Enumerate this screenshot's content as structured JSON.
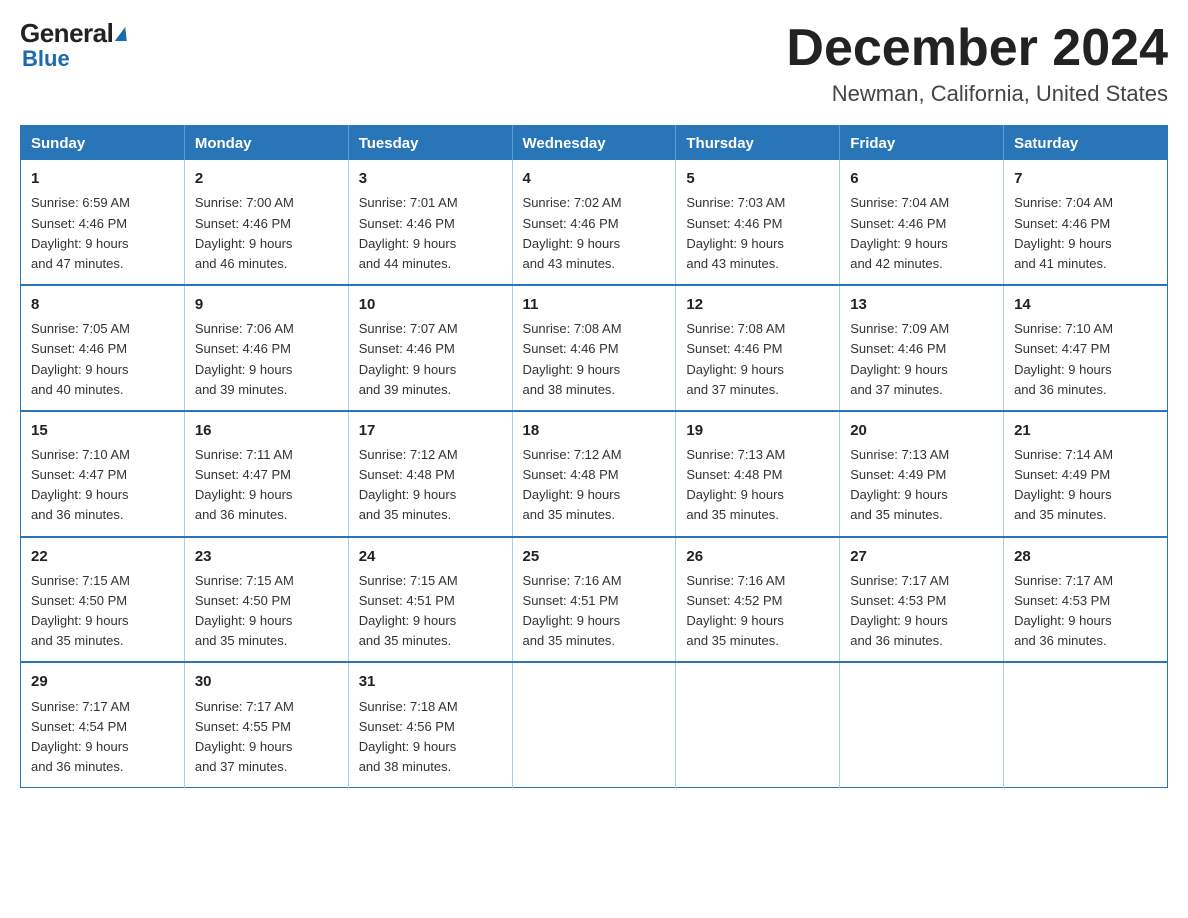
{
  "logo": {
    "general": "General",
    "arrow_symbol": "▶",
    "blue": "Blue"
  },
  "header": {
    "title": "December 2024",
    "subtitle": "Newman, California, United States"
  },
  "weekdays": [
    "Sunday",
    "Monday",
    "Tuesday",
    "Wednesday",
    "Thursday",
    "Friday",
    "Saturday"
  ],
  "weeks": [
    [
      {
        "day": "1",
        "sunrise": "6:59 AM",
        "sunset": "4:46 PM",
        "daylight": "9 hours and 47 minutes."
      },
      {
        "day": "2",
        "sunrise": "7:00 AM",
        "sunset": "4:46 PM",
        "daylight": "9 hours and 46 minutes."
      },
      {
        "day": "3",
        "sunrise": "7:01 AM",
        "sunset": "4:46 PM",
        "daylight": "9 hours and 44 minutes."
      },
      {
        "day": "4",
        "sunrise": "7:02 AM",
        "sunset": "4:46 PM",
        "daylight": "9 hours and 43 minutes."
      },
      {
        "day": "5",
        "sunrise": "7:03 AM",
        "sunset": "4:46 PM",
        "daylight": "9 hours and 43 minutes."
      },
      {
        "day": "6",
        "sunrise": "7:04 AM",
        "sunset": "4:46 PM",
        "daylight": "9 hours and 42 minutes."
      },
      {
        "day": "7",
        "sunrise": "7:04 AM",
        "sunset": "4:46 PM",
        "daylight": "9 hours and 41 minutes."
      }
    ],
    [
      {
        "day": "8",
        "sunrise": "7:05 AM",
        "sunset": "4:46 PM",
        "daylight": "9 hours and 40 minutes."
      },
      {
        "day": "9",
        "sunrise": "7:06 AM",
        "sunset": "4:46 PM",
        "daylight": "9 hours and 39 minutes."
      },
      {
        "day": "10",
        "sunrise": "7:07 AM",
        "sunset": "4:46 PM",
        "daylight": "9 hours and 39 minutes."
      },
      {
        "day": "11",
        "sunrise": "7:08 AM",
        "sunset": "4:46 PM",
        "daylight": "9 hours and 38 minutes."
      },
      {
        "day": "12",
        "sunrise": "7:08 AM",
        "sunset": "4:46 PM",
        "daylight": "9 hours and 37 minutes."
      },
      {
        "day": "13",
        "sunrise": "7:09 AM",
        "sunset": "4:46 PM",
        "daylight": "9 hours and 37 minutes."
      },
      {
        "day": "14",
        "sunrise": "7:10 AM",
        "sunset": "4:47 PM",
        "daylight": "9 hours and 36 minutes."
      }
    ],
    [
      {
        "day": "15",
        "sunrise": "7:10 AM",
        "sunset": "4:47 PM",
        "daylight": "9 hours and 36 minutes."
      },
      {
        "day": "16",
        "sunrise": "7:11 AM",
        "sunset": "4:47 PM",
        "daylight": "9 hours and 36 minutes."
      },
      {
        "day": "17",
        "sunrise": "7:12 AM",
        "sunset": "4:48 PM",
        "daylight": "9 hours and 35 minutes."
      },
      {
        "day": "18",
        "sunrise": "7:12 AM",
        "sunset": "4:48 PM",
        "daylight": "9 hours and 35 minutes."
      },
      {
        "day": "19",
        "sunrise": "7:13 AM",
        "sunset": "4:48 PM",
        "daylight": "9 hours and 35 minutes."
      },
      {
        "day": "20",
        "sunrise": "7:13 AM",
        "sunset": "4:49 PM",
        "daylight": "9 hours and 35 minutes."
      },
      {
        "day": "21",
        "sunrise": "7:14 AM",
        "sunset": "4:49 PM",
        "daylight": "9 hours and 35 minutes."
      }
    ],
    [
      {
        "day": "22",
        "sunrise": "7:15 AM",
        "sunset": "4:50 PM",
        "daylight": "9 hours and 35 minutes."
      },
      {
        "day": "23",
        "sunrise": "7:15 AM",
        "sunset": "4:50 PM",
        "daylight": "9 hours and 35 minutes."
      },
      {
        "day": "24",
        "sunrise": "7:15 AM",
        "sunset": "4:51 PM",
        "daylight": "9 hours and 35 minutes."
      },
      {
        "day": "25",
        "sunrise": "7:16 AM",
        "sunset": "4:51 PM",
        "daylight": "9 hours and 35 minutes."
      },
      {
        "day": "26",
        "sunrise": "7:16 AM",
        "sunset": "4:52 PM",
        "daylight": "9 hours and 35 minutes."
      },
      {
        "day": "27",
        "sunrise": "7:17 AM",
        "sunset": "4:53 PM",
        "daylight": "9 hours and 36 minutes."
      },
      {
        "day": "28",
        "sunrise": "7:17 AM",
        "sunset": "4:53 PM",
        "daylight": "9 hours and 36 minutes."
      }
    ],
    [
      {
        "day": "29",
        "sunrise": "7:17 AM",
        "sunset": "4:54 PM",
        "daylight": "9 hours and 36 minutes."
      },
      {
        "day": "30",
        "sunrise": "7:17 AM",
        "sunset": "4:55 PM",
        "daylight": "9 hours and 37 minutes."
      },
      {
        "day": "31",
        "sunrise": "7:18 AM",
        "sunset": "4:56 PM",
        "daylight": "9 hours and 38 minutes."
      },
      null,
      null,
      null,
      null
    ]
  ],
  "labels": {
    "sunrise": "Sunrise:",
    "sunset": "Sunset:",
    "daylight": "Daylight:"
  }
}
